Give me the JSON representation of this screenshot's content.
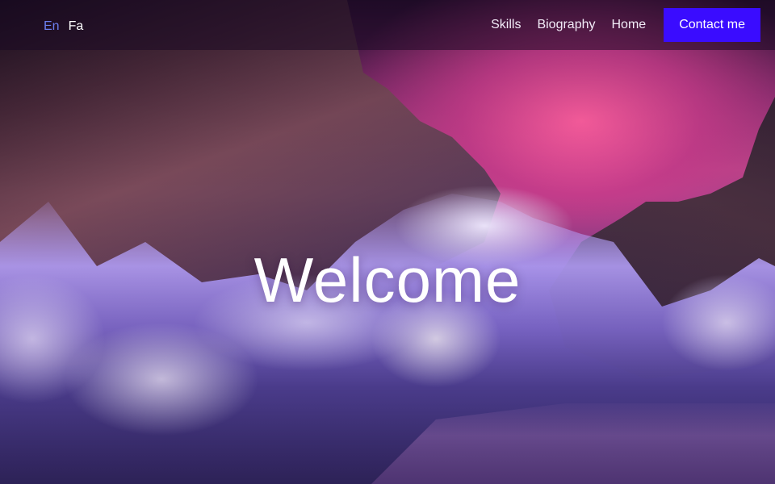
{
  "header": {
    "languages": [
      {
        "label": "En",
        "active": true
      },
      {
        "label": "Fa",
        "active": false
      }
    ],
    "nav": [
      {
        "label": "Skills"
      },
      {
        "label": "Biography"
      },
      {
        "label": "Home"
      }
    ],
    "contact_label": "Contact me"
  },
  "hero": {
    "heading": "Welcome",
    "background_image": "icy rocky canyon at dusk with pink sky"
  },
  "colors": {
    "accent": "#3a0cff",
    "active_language": "#6b7ff0",
    "navbar_bg": "rgba(25,10,35,0.55)"
  }
}
